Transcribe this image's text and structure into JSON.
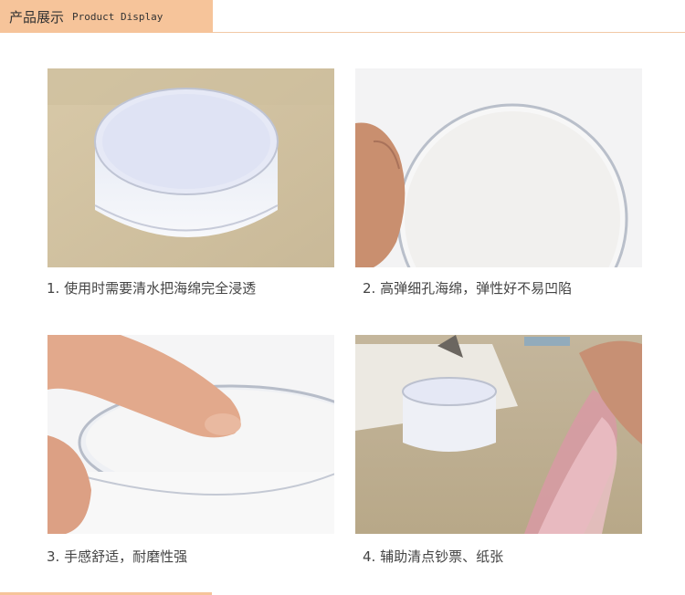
{
  "header": {
    "title_cn": "产品展示",
    "title_en": "Product Display"
  },
  "products": [
    {
      "caption": "1. 使用时需要清水把海绵完全浸透"
    },
    {
      "caption": "2. 高弹细孔海绵，弹性好不易凹陷"
    },
    {
      "caption": "3. 手感舒适，耐磨性强"
    },
    {
      "caption": "4. 辅助清点钞票、纸张"
    }
  ],
  "colors": {
    "header_tab": "#f6c49a",
    "header_line": "#f2c9a6",
    "caption_text": "#444444"
  }
}
